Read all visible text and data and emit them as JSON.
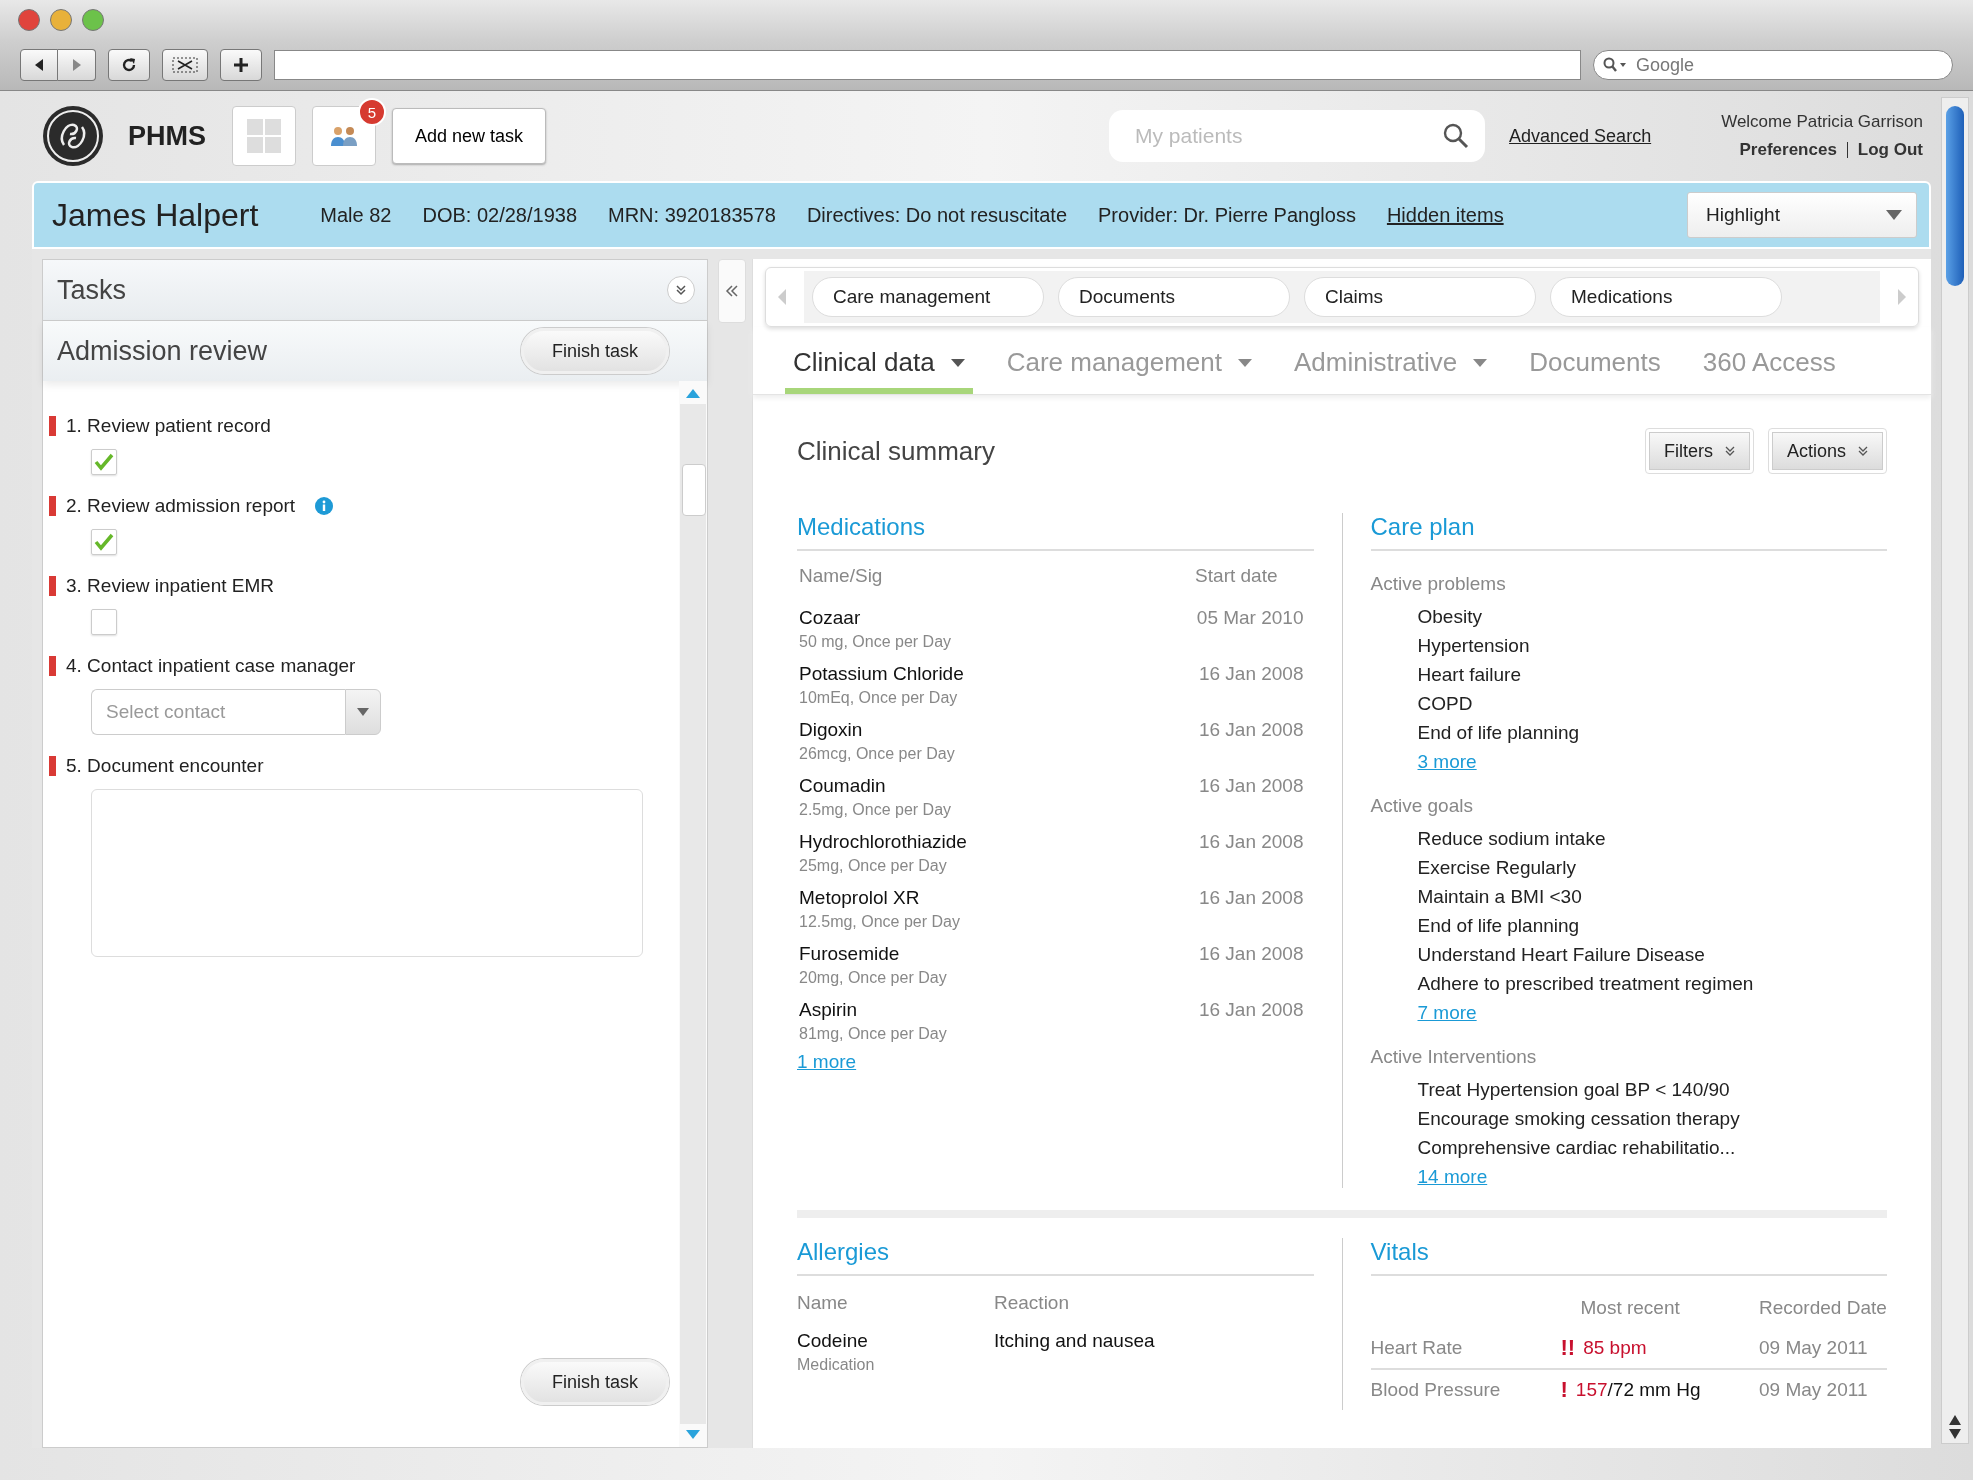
{
  "browser": {
    "search_placeholder": "Google"
  },
  "app": {
    "name": "PHMS",
    "notification_count": "5",
    "add_task": "Add new task",
    "search_placeholder": "My patients",
    "advanced_search": "Advanced Search",
    "welcome": "Welcome Patricia Garrison",
    "links": [
      "Preferences",
      "Log Out"
    ]
  },
  "patient": {
    "name": "James Halpert",
    "facts": [
      "Male 82",
      "DOB: 02/28/1938",
      "MRN: 3920183578",
      "Directives: Do not resuscitate",
      "Provider: Dr. Pierre Pangloss"
    ],
    "hidden_items": "Hidden items",
    "highlight": "Highlight"
  },
  "tasks": {
    "title": "Tasks",
    "task_name": "Admission review",
    "finish": "Finish task",
    "finish_bottom": "Finish task",
    "items": [
      {
        "label": "1. Review patient record",
        "kind": "checkbox",
        "checked": true,
        "info": false
      },
      {
        "label": "2. Review admission report",
        "kind": "checkbox",
        "checked": true,
        "info": true
      },
      {
        "label": "3. Review inpatient EMR",
        "kind": "checkbox",
        "checked": false,
        "info": false
      },
      {
        "label": "4. Contact inpatient case manager",
        "kind": "select",
        "placeholder": "Select contact",
        "info": false
      },
      {
        "label": "5. Document encounter",
        "kind": "textarea",
        "info": false
      }
    ]
  },
  "quick_tabs": [
    "Care management",
    "Documents",
    "Claims",
    "Medications"
  ],
  "tabs": [
    {
      "label": "Clinical data",
      "selected": true,
      "menu": true
    },
    {
      "label": "Care management",
      "selected": false,
      "menu": true
    },
    {
      "label": "Administrative",
      "selected": false,
      "menu": true
    },
    {
      "label": "Documents",
      "selected": false,
      "menu": false
    },
    {
      "label": "360 Access",
      "selected": false,
      "menu": false
    }
  ],
  "summary": {
    "title": "Clinical summary",
    "buttons": [
      "Filters",
      "Actions"
    ],
    "medications": {
      "title": "Medications",
      "columns": [
        "Name/Sig",
        "Start date"
      ],
      "more": "1 more",
      "rows": [
        {
          "name": "Cozaar",
          "sig": "50 mg, Once per Day",
          "date": "05 Mar 2010"
        },
        {
          "name": "Potassium Chloride",
          "sig": "10mEq, Once per Day",
          "date": "16 Jan 2008"
        },
        {
          "name": "Digoxin",
          "sig": "26mcg, Once per Day",
          "date": "16 Jan 2008"
        },
        {
          "name": "Coumadin",
          "sig": "2.5mg, Once per Day",
          "date": "16 Jan 2008"
        },
        {
          "name": "Hydrochlorothiazide",
          "sig": "25mg, Once per Day",
          "date": "16 Jan 2008"
        },
        {
          "name": "Metoprolol XR",
          "sig": "12.5mg, Once per Day",
          "date": "16 Jan 2008"
        },
        {
          "name": "Furosemide",
          "sig": "20mg, Once per Day",
          "date": "16 Jan 2008"
        },
        {
          "name": "Aspirin",
          "sig": "81mg, Once per Day",
          "date": "16 Jan 2008"
        }
      ]
    },
    "care_plan": {
      "title": "Care plan",
      "groups": [
        {
          "title": "Active problems",
          "items": [
            "Obesity",
            "Hypertension",
            "Heart failure",
            "COPD",
            "End of life planning"
          ],
          "more": "3 more"
        },
        {
          "title": "Active goals",
          "items": [
            "Reduce sodium intake",
            "Exercise Regularly",
            "Maintain a BMI <30",
            "End of life planning",
            "Understand Heart Failure Disease",
            "Adhere to prescribed treatment regimen"
          ],
          "more": "7 more"
        },
        {
          "title": "Active Interventions",
          "items": [
            "Treat Hypertension goal BP < 140/90",
            "Encourage smoking cessation therapy",
            "Comprehensive cardiac rehabilitatio..."
          ],
          "more": "14 more"
        }
      ]
    },
    "allergies": {
      "title": "Allergies",
      "columns": [
        "Name",
        "Reaction"
      ],
      "rows": [
        {
          "name": "Codeine",
          "type": "Medication",
          "reaction": "Itching and nausea"
        }
      ]
    },
    "vitals": {
      "title": "Vitals",
      "columns": [
        "Most recent",
        "Recorded Date"
      ],
      "rows": [
        {
          "name": "Heart Rate",
          "alert": "!!",
          "value_alert": "85 bpm",
          "date": "09 May 2011"
        },
        {
          "name": "Blood Pressure",
          "alert": "!",
          "value_alert": "157",
          "value_rest": "/72 mm Hg",
          "date": "09 May 2011"
        }
      ]
    }
  }
}
